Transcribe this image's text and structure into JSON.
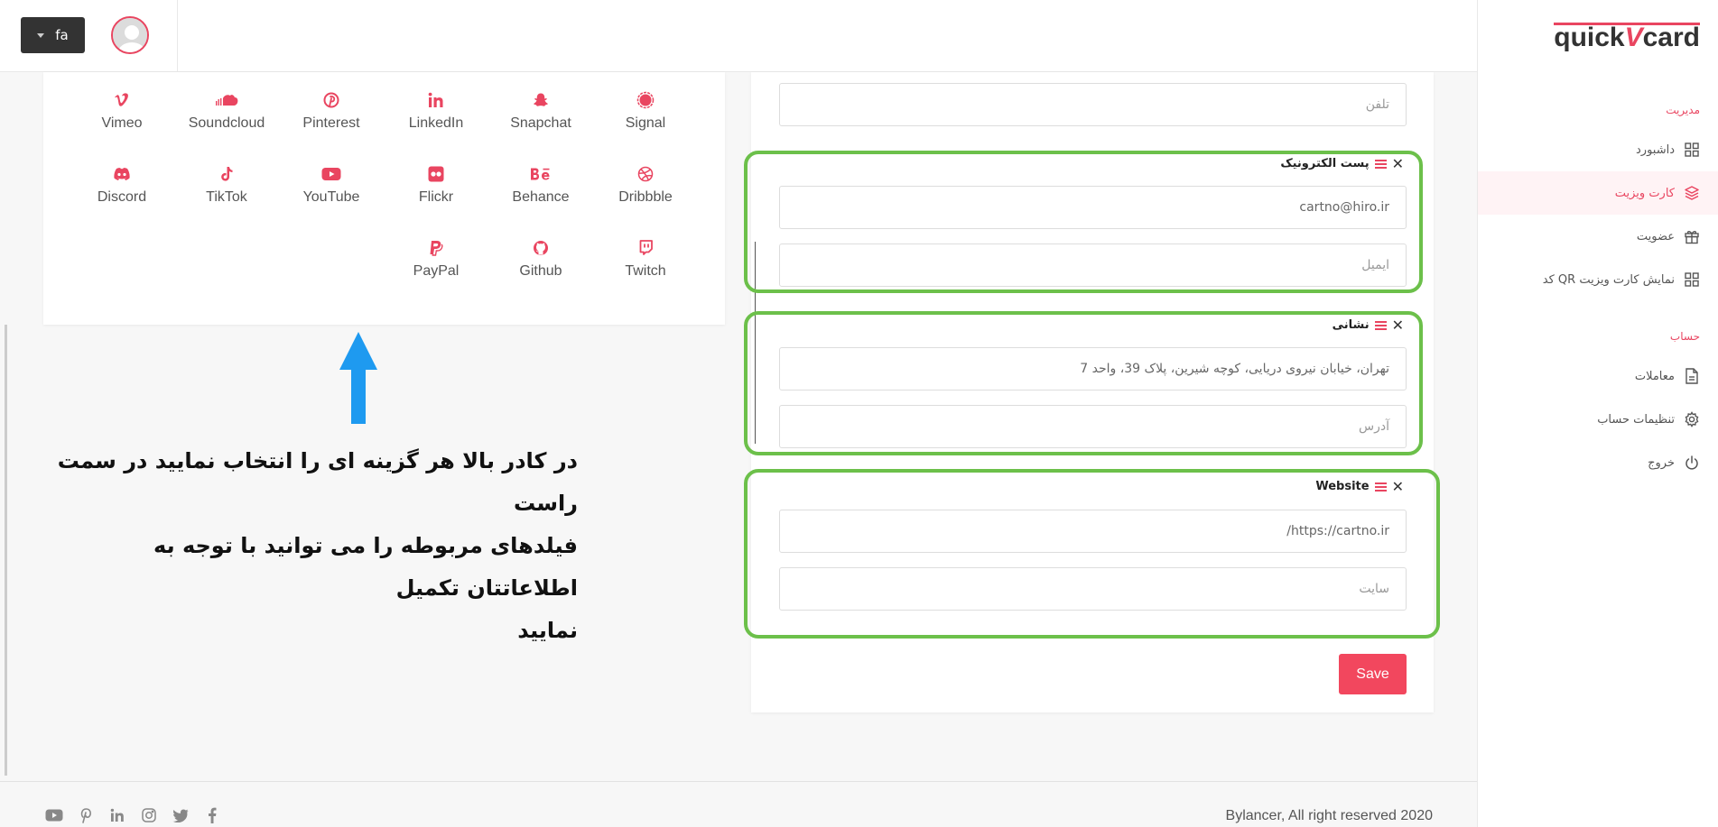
{
  "header": {
    "language": "fa"
  },
  "sidebar": {
    "logo": {
      "part1": "quick",
      "part2": "V",
      "part3": "card"
    },
    "sections": [
      {
        "title": "مدیریت"
      },
      {
        "title": "حساب"
      }
    ],
    "items": [
      {
        "label": "داشبورد",
        "icon": "grid-icon"
      },
      {
        "label": "کارت ویزیت",
        "icon": "layers-icon"
      },
      {
        "label": "عضویت",
        "icon": "gift-icon"
      },
      {
        "label": "کد QR نمایش کارت ویزیت",
        "icon": "qr-icon"
      },
      {
        "label": "معاملات",
        "icon": "document-icon"
      },
      {
        "label": "تنظیمات حساب",
        "icon": "gear-icon"
      },
      {
        "label": "خروج",
        "icon": "power-icon"
      }
    ]
  },
  "social": {
    "items": [
      "Vimeo",
      "Soundcloud",
      "Pinterest",
      "LinkedIn",
      "Snapchat",
      "Signal",
      "Discord",
      "TikTok",
      "YouTube",
      "Flickr",
      "Behance",
      "Dribbble",
      "PayPal",
      "Github",
      "Twitch"
    ]
  },
  "annotation": {
    "line1": "در کادر بالا هر گزینه ای را انتخاب نمایید در سمت راست",
    "line2": "فیلدهای مربوطه را می توانید با توجه به اطلاعاتتان تکمیل",
    "line3": "نمایید"
  },
  "form": {
    "phone_placeholder": "تلفن",
    "groups": [
      {
        "title": "پست الکترونیک",
        "value": "cartno@hiro.ir",
        "label_placeholder": "ایمیل"
      },
      {
        "title": "نشانی",
        "value": "تهران، خیابان نیروی دریایی، کوچه شیرین، پلاک 39، واحد 7",
        "label_placeholder": "آدرس"
      },
      {
        "title": "Website",
        "value": "https://cartno.ir/",
        "label_placeholder": "سایت"
      }
    ],
    "save_label": "Save"
  },
  "footer": {
    "copyright": "Bylancer, All right reserved 2020",
    "icons": [
      "youtube-icon",
      "pinterest-icon",
      "linkedin-icon",
      "instagram-icon",
      "twitter-icon",
      "facebook-icon"
    ]
  },
  "colors": {
    "accent": "#e94560",
    "highlight_border": "#6cc04a",
    "annotation_arrow": "#1e9af0"
  }
}
